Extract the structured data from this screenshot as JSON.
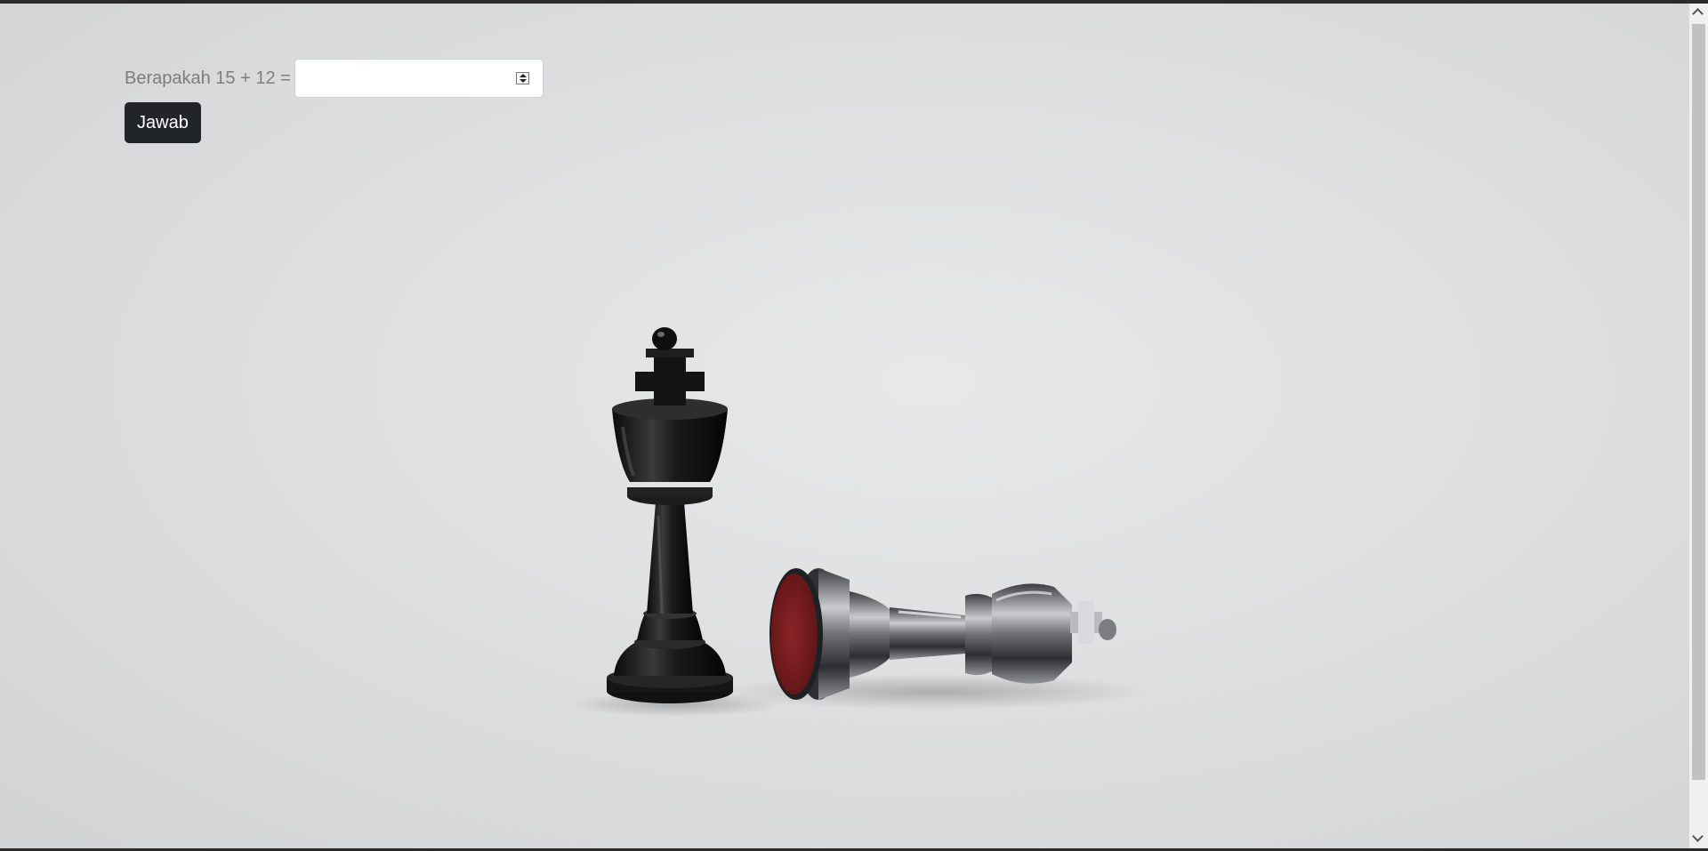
{
  "quiz": {
    "question": "Berapakah 15 + 12 =",
    "answer_value": "",
    "submit_label": "Jawab"
  },
  "background": {
    "subject": "chess-kings-photo",
    "colors": {
      "backdrop": "#dedfe0",
      "piece_black": "#141414",
      "piece_silver": "#8a8d92",
      "felt_red": "#7a1b1e",
      "button": "#212529"
    }
  },
  "icons": {
    "spinner": "number-spinner-icon",
    "scroll_up": "chevron-up-icon",
    "scroll_down": "chevron-down-icon"
  }
}
